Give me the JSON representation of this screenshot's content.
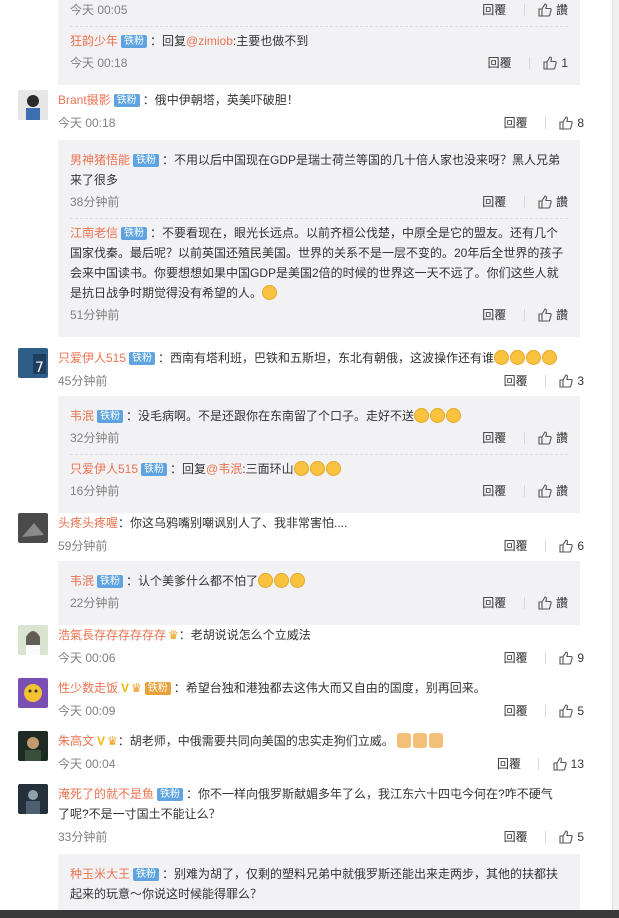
{
  "labels": {
    "reply": "回覆",
    "like": "讚",
    "badge": "铁粉",
    "badge_gold": "铁粉"
  },
  "top_box": [
    {
      "time": "今天 00:05",
      "likes": "讚"
    },
    {
      "name": "狂韵少年",
      "prefix": "：回复",
      "at": "@zimiob",
      "text": ":主要也做不到",
      "time": "今天 00:18",
      "likes": "1"
    }
  ],
  "comments": [
    {
      "name": "Brant摄影",
      "text": "：俄中伊朝塔，英美吓破胆！",
      "time": "今天 00:18",
      "likes": "8",
      "replies": [
        {
          "name": "男神猪悟能",
          "text": "：不用以后中国现在GDP是瑞士荷兰等国的几十倍人家也没来呀？黑人兄弟来了很多",
          "time": "38分钟前",
          "likes": "讚"
        },
        {
          "name": "江南老信",
          "text": "：不要看现在，眼光长远点。以前齐桓公伐楚，中原全是它的盟友。还有几个国家伐秦。最后呢？以前英国还殖民美国。世界的关系不是一层不变的。20年后全世界的孩子会来中国读书。你要想想如果中国GDP是美国2倍的时候的世界这一天不远了。你们这些人就是抗日战争时期觉得没有希望的人。",
          "time": "51分钟前",
          "likes": "讚"
        }
      ]
    },
    {
      "name": "只爱伊人515",
      "text": "：西南有塔利班，巴铁和五斯坦，东北有朝俄，这波操作还有谁",
      "time": "45分钟前",
      "likes": "3",
      "replies": [
        {
          "name": "韦泯",
          "text": "：没毛病啊。不是还跟你在东南留了个口子。走好不送",
          "time": "32分钟前",
          "likes": "讚"
        },
        {
          "name": "只爱伊人515",
          "prefix": "：回复",
          "at": "@韦泯",
          "text": ":三面环山",
          "time": "16分钟前",
          "likes": "讚"
        }
      ]
    },
    {
      "name": "头疼头疼喔",
      "text": "：你这乌鸦嘴别嘲讽别人了、我非常害怕....",
      "time": "59分钟前",
      "likes": "6",
      "replies": [
        {
          "name": "韦泯",
          "text": "：认个美爹什么都不怕了",
          "time": "22分钟前",
          "likes": "讚"
        }
      ]
    },
    {
      "name": "浩氣長存存存存存存",
      "text": "：老胡说说怎么个立威法",
      "time": "今天 00:06",
      "likes": "9",
      "replies": []
    },
    {
      "name": "性少数走饭",
      "text": "：希望台独和港独都去这伟大而又自由的国度，别再回来。",
      "time": "今天 00:09",
      "likes": "5",
      "replies": []
    },
    {
      "name": "朱高文",
      "text": "：胡老师，中俄需要共同向美国的忠实走狗们立威。",
      "time": "今天 00:04",
      "likes": "13",
      "replies": []
    },
    {
      "name": "淹死了的就不是鱼",
      "text": "：你不一样向俄罗斯献媚多年了么，我江东六十四屯今何在?咋不硬气了呢?不是一寸国土不能让么？",
      "time": "33分钟前",
      "likes": "5",
      "replies": [
        {
          "name": "种玉米大王",
          "text": "：别难为胡了，仅剩的塑料兄弟中就俄罗斯还能出来走两步，其他的扶都扶起来的玩意～你说这时候能得罪么？"
        }
      ]
    }
  ]
}
